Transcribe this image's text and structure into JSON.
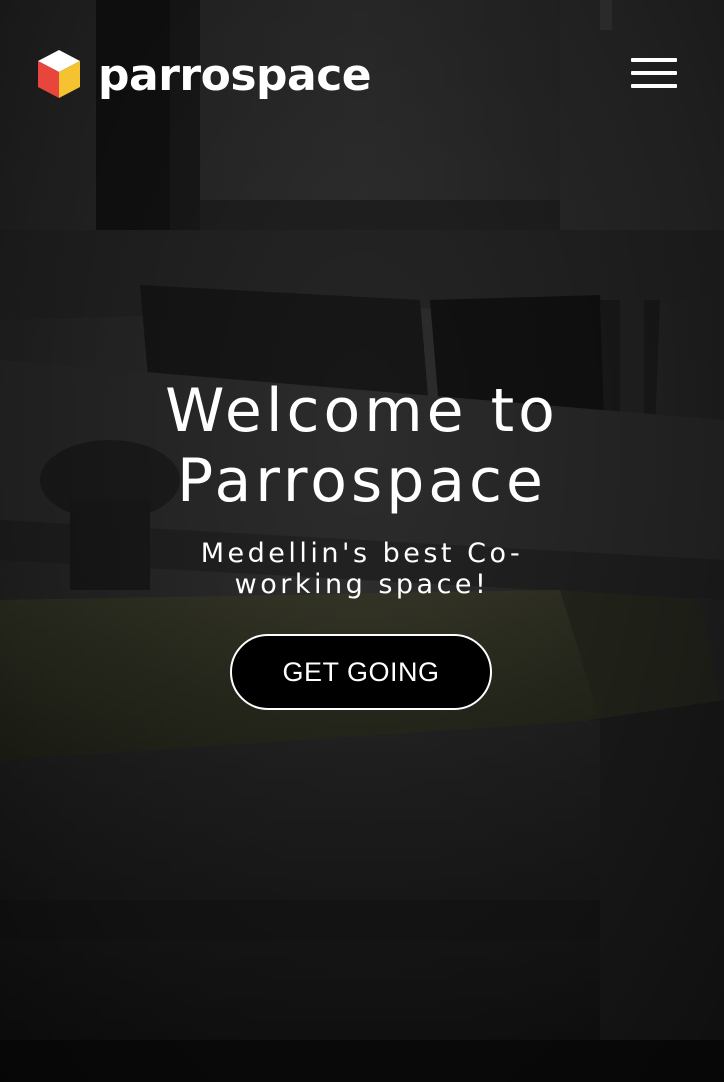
{
  "header": {
    "logo_text": "parrospace",
    "logo_icon": "cube-logo-icon",
    "menu_icon": "hamburger-menu-icon"
  },
  "hero": {
    "title": "Welcome to Parrospace",
    "subtitle": "Medellin's best Co-working space!",
    "cta_label": "GET GOING"
  },
  "colors": {
    "cube_top": "#ffffff",
    "cube_left": "#e8453c",
    "cube_right": "#f5c330",
    "cta_background": "#000000",
    "text": "#ffffff"
  }
}
